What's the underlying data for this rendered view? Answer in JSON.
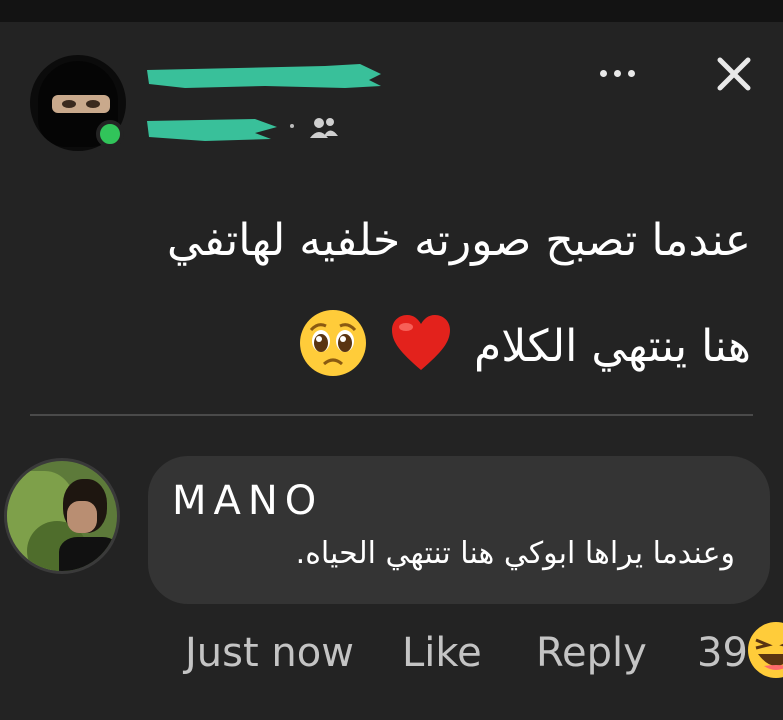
{
  "post": {
    "author_redacted": true,
    "line1": "عندما تصبح صورته خلفيه لهاتفي",
    "line2": "هنا ينتهي الكلام",
    "emojis": [
      "red-heart",
      "pleading-face"
    ]
  },
  "comment": {
    "author": "MANO",
    "text": "وعندما يراها ابوكي هنا تنتهي الحياه.",
    "time": "Just now",
    "like_label": "Like",
    "reply_label": "Reply",
    "reaction_count": "39",
    "reaction_icon": "laughing-face-icon"
  },
  "colors": {
    "background": "#232323",
    "online": "#31c45a",
    "redaction": "#39c09a",
    "bubble": "#343434"
  }
}
